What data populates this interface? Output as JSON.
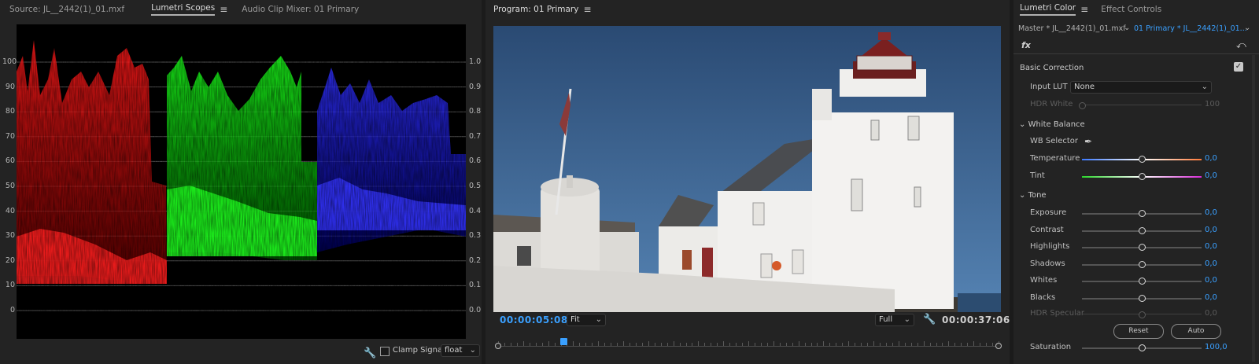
{
  "scopes": {
    "tabs": [
      {
        "label": "Source: JL__2442(1)_01.mxf",
        "active": false
      },
      {
        "label": "Lumetri Scopes",
        "active": true
      },
      {
        "label": "Audio Clip Mixer: 01 Primary",
        "active": false
      }
    ],
    "left_scale": [
      "100",
      "90",
      "80",
      "70",
      "60",
      "50",
      "40",
      "30",
      "20",
      "10",
      "0"
    ],
    "right_scale": [
      "1.0",
      "0.9",
      "0.8",
      "0.7",
      "0.6",
      "0.5",
      "0.4",
      "0.3",
      "0.2",
      "0.1",
      "0.0"
    ],
    "clamp_label": "Clamp Signal",
    "clamp_checked": false,
    "depth_value": "float",
    "colors": {
      "red": "#ff1a1a",
      "green": "#1aff1a",
      "blue": "#1a1aff"
    }
  },
  "program": {
    "title": "Program: 01 Primary",
    "current_timecode": "00:00:05:08",
    "fit_value": "Fit",
    "resolution_value": "Full",
    "duration_timecode": "00:00:37:06",
    "playhead_fraction": 0.13
  },
  "lumetri": {
    "tabs": [
      {
        "label": "Lumetri Color",
        "active": true
      },
      {
        "label": "Effect Controls",
        "active": false
      }
    ],
    "master_label": "Master * JL__2442(1)_01.mxf",
    "clip_label": "01 Primary * JL__2442(1)_01...",
    "fx_label": "fx",
    "basic_correction": "Basic Correction",
    "input_lut_label": "Input LUT",
    "input_lut_value": "None",
    "hdr_white_label": "HDR White",
    "hdr_white_value": "100",
    "white_balance": "White Balance",
    "wb_selector": "WB Selector",
    "temperature": {
      "label": "Temperature",
      "value": "0,0",
      "position": 0.5
    },
    "tint": {
      "label": "Tint",
      "value": "0,0",
      "position": 0.5
    },
    "tone": "Tone",
    "tone_rows": [
      {
        "label": "Exposure",
        "value": "0,0"
      },
      {
        "label": "Contrast",
        "value": "0,0"
      },
      {
        "label": "Highlights",
        "value": "0,0"
      },
      {
        "label": "Shadows",
        "value": "0,0"
      },
      {
        "label": "Whites",
        "value": "0,0"
      },
      {
        "label": "Blacks",
        "value": "0,0"
      }
    ],
    "hdr_specular_label": "HDR Specular",
    "hdr_specular_value": "0,0",
    "reset_label": "Reset",
    "auto_label": "Auto",
    "saturation": {
      "label": "Saturation",
      "value": "100,0",
      "position": 0.5
    },
    "accent": "#3aa0ff"
  }
}
